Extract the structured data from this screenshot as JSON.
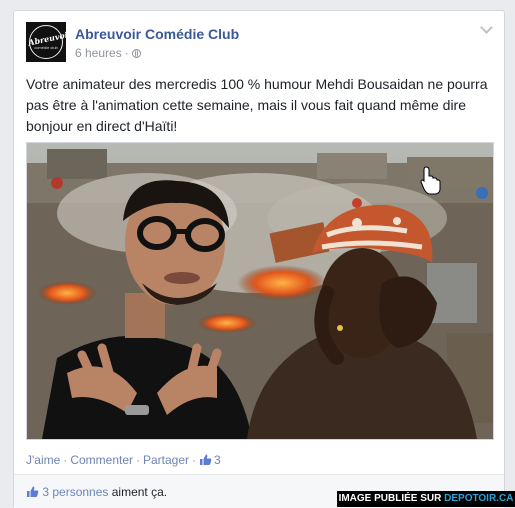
{
  "post": {
    "page_name": "Abreuvoir Comédie Club",
    "time": "6 heures",
    "time_sep": "·",
    "text": "Votre animateur des mercredis 100 % humour Mehdi Bousaidan ne pourra pas être à l'animation cette semaine, mais il vous fait quand même dire bonjour en direct d'Haïti!",
    "avatar_logo": "Abreuvoir",
    "avatar_sub": "comédie club"
  },
  "actions": {
    "like": "J'aime",
    "comment": "Commenter",
    "share": "Partager",
    "sep": "·",
    "like_count": "3"
  },
  "likes_summary": {
    "people": "3 personnes",
    "rest": "aiment ça."
  },
  "watermark": {
    "prefix": "IMAGE PUBLIÉE SUR",
    "site": "DEPOTOIR.CA"
  },
  "colors": {
    "link": "#3b5998",
    "action": "#6d84b4",
    "meta": "#90949c"
  },
  "icons": [
    "globe-icon",
    "chevron-down-icon",
    "thumbs-up-icon",
    "hand-cursor-icon"
  ]
}
